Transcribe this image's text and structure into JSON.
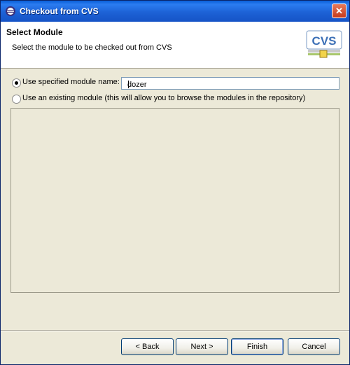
{
  "window": {
    "title": "Checkout from CVS",
    "close_glyph": "✕"
  },
  "header": {
    "title": "Select Module",
    "description": "Select the module to be checked out from CVS",
    "logo_text": "CVS"
  },
  "options": {
    "specified": {
      "label": "Use specified module name:",
      "checked": true
    },
    "existing": {
      "label": "Use an existing module (this will allow you to browse the modules in the repository)",
      "checked": false
    }
  },
  "module_input": {
    "value": "dozer"
  },
  "buttons": {
    "back": "< Back",
    "next": "Next >",
    "finish": "Finish",
    "cancel": "Cancel"
  },
  "colors": {
    "titlebar": "#1d62d6",
    "dialog_bg": "#ece9d8",
    "accent": "#0a246a"
  }
}
